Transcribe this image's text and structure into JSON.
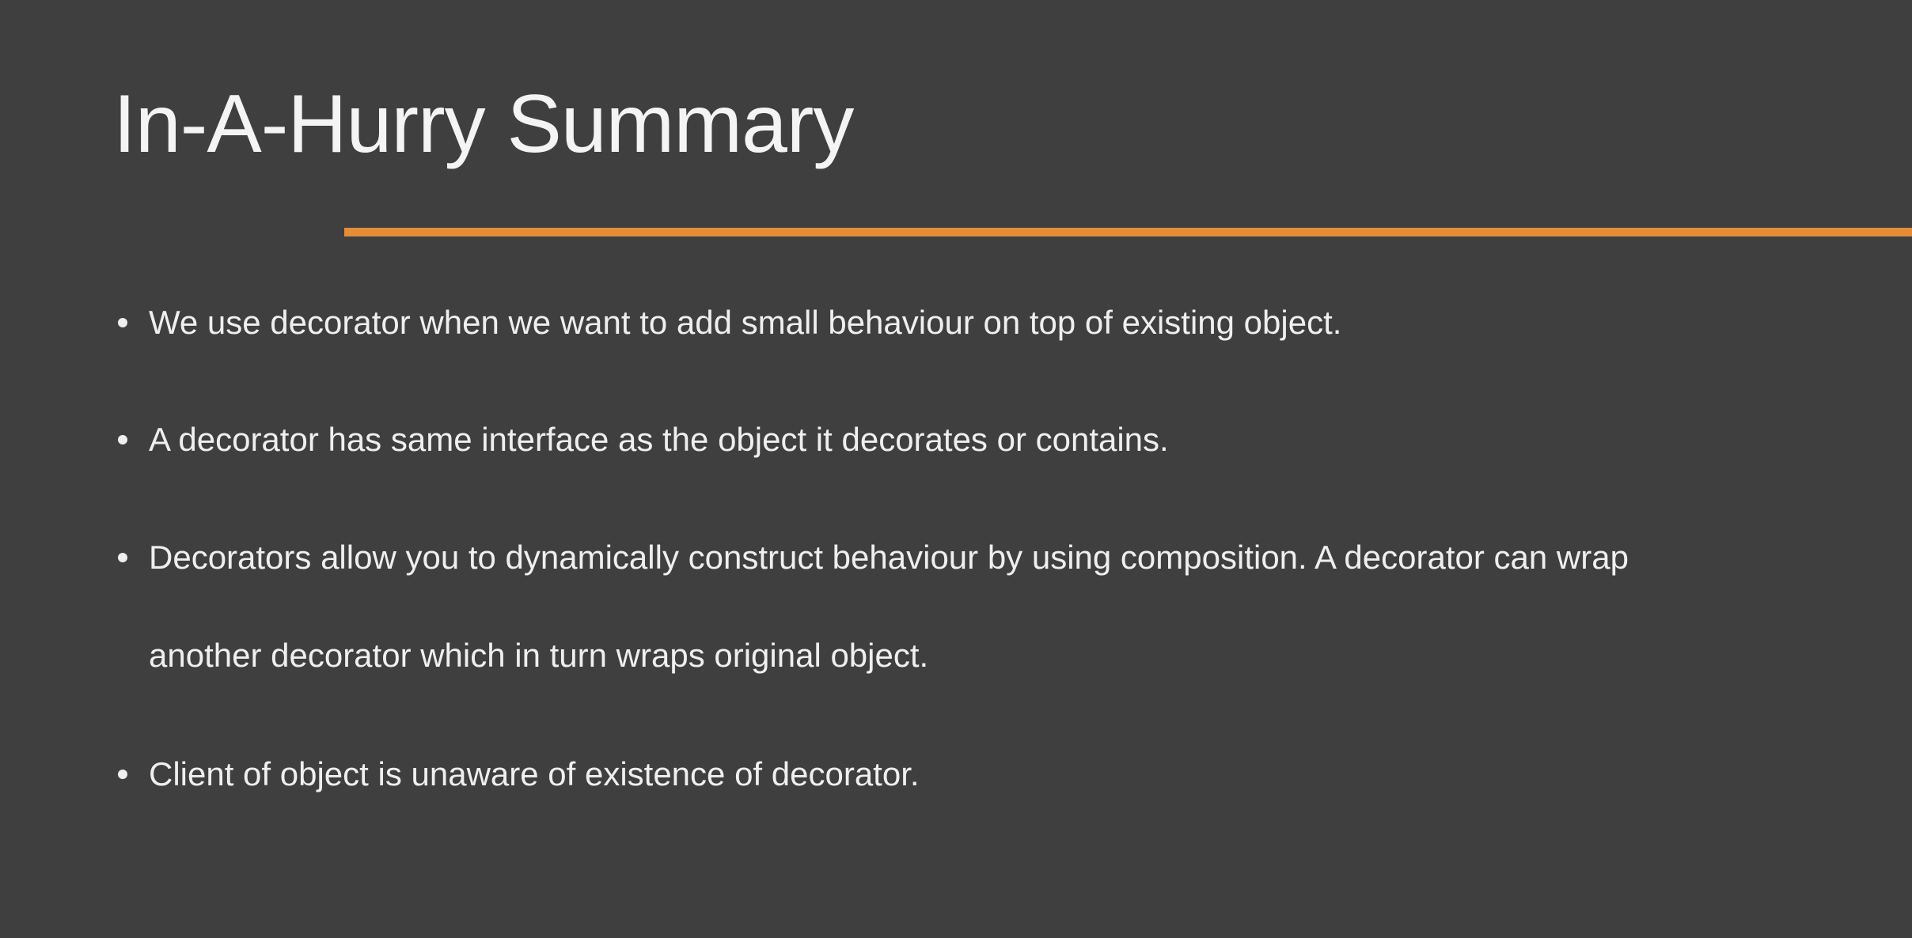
{
  "slide": {
    "title": "In-A-Hurry Summary",
    "accent_color": "#e48d36",
    "background_color": "#3f3f3f",
    "bullets": [
      {
        "text": "We use decorator when we want to add small behaviour on top of existing object."
      },
      {
        "text": "A decorator has same interface as the object it decorates or contains."
      },
      {
        "text_line_1": "Decorators allow you to dynamically construct behaviour by using composition. A decorator can wrap",
        "text_line_2": "another decorator which in turn wraps original object."
      },
      {
        "text": "Client of object is unaware of existence of decorator."
      }
    ]
  }
}
